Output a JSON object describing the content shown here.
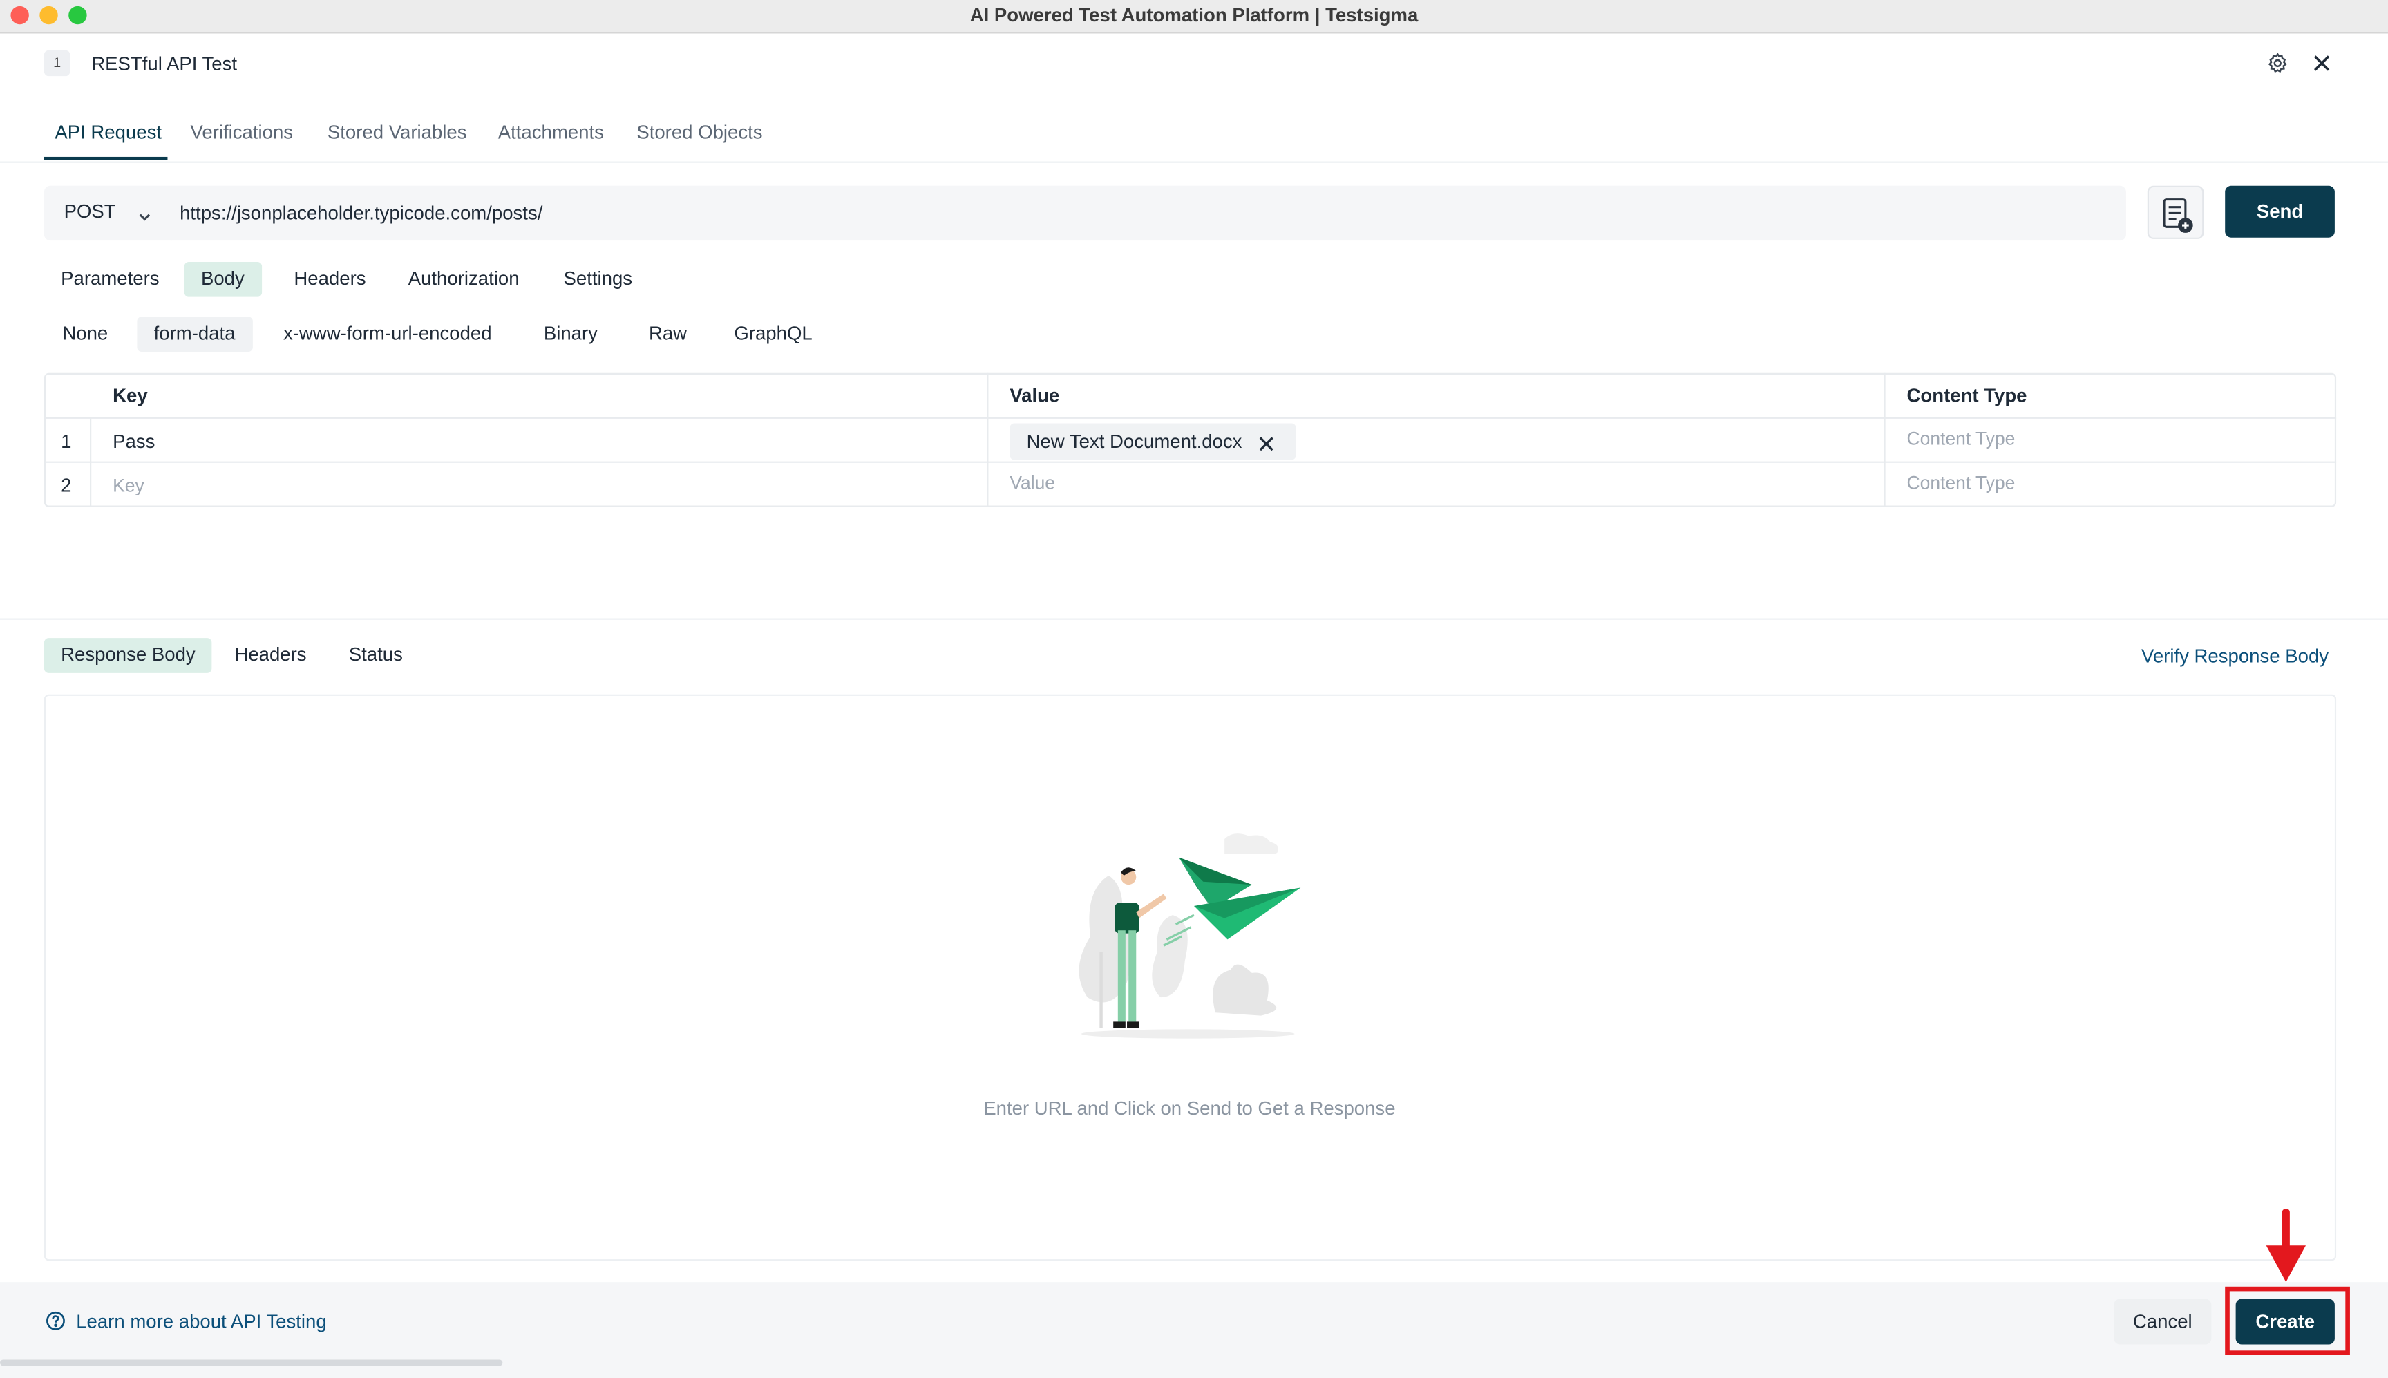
{
  "window": {
    "title": "AI Powered Test Automation Platform | Testsigma"
  },
  "header": {
    "step_number": "1",
    "step_title": "RESTful API Test"
  },
  "main_tabs": [
    {
      "label": "API Request",
      "active": true
    },
    {
      "label": "Verifications",
      "active": false
    },
    {
      "label": "Stored Variables",
      "active": false
    },
    {
      "label": "Attachments",
      "active": false
    },
    {
      "label": "Stored Objects",
      "active": false
    }
  ],
  "request": {
    "method": "POST",
    "url": "https://jsonplaceholder.typicode.com/posts/",
    "send_label": "Send"
  },
  "request_tabs": [
    {
      "label": "Parameters",
      "active": false
    },
    {
      "label": "Body",
      "active": true
    },
    {
      "label": "Headers",
      "active": false
    },
    {
      "label": "Authorization",
      "active": false
    },
    {
      "label": "Settings",
      "active": false
    }
  ],
  "body_types": [
    {
      "label": "None",
      "active": false
    },
    {
      "label": "form-data",
      "active": true
    },
    {
      "label": "x-www-form-url-encoded",
      "active": false
    },
    {
      "label": "Binary",
      "active": false
    },
    {
      "label": "Raw",
      "active": false
    },
    {
      "label": "GraphQL",
      "active": false
    }
  ],
  "form_table": {
    "headers": {
      "key": "Key",
      "value": "Value",
      "content_type": "Content Type"
    },
    "rows": [
      {
        "index": "1",
        "key": "Pass",
        "value_file": "New Text Document.docx",
        "content_type_placeholder": "Content Type"
      },
      {
        "index": "2",
        "key_placeholder": "Key",
        "value_placeholder": "Value",
        "content_type_placeholder": "Content Type"
      }
    ]
  },
  "response_tabs": [
    {
      "label": "Response Body",
      "active": true
    },
    {
      "label": "Headers",
      "active": false
    },
    {
      "label": "Status",
      "active": false
    }
  ],
  "response": {
    "verify_link": "Verify Response Body",
    "empty_message": "Enter URL and Click on Send to Get a Response"
  },
  "footer": {
    "learn_more": "Learn more about API Testing",
    "cancel_label": "Cancel",
    "create_label": "Create"
  },
  "colors": {
    "primary": "#0b3b4e",
    "active_tab_bg": "#dcefe8",
    "link": "#0b4f7a",
    "illustration_green": "#1ea76b",
    "annotation_red": "#e3181e"
  }
}
